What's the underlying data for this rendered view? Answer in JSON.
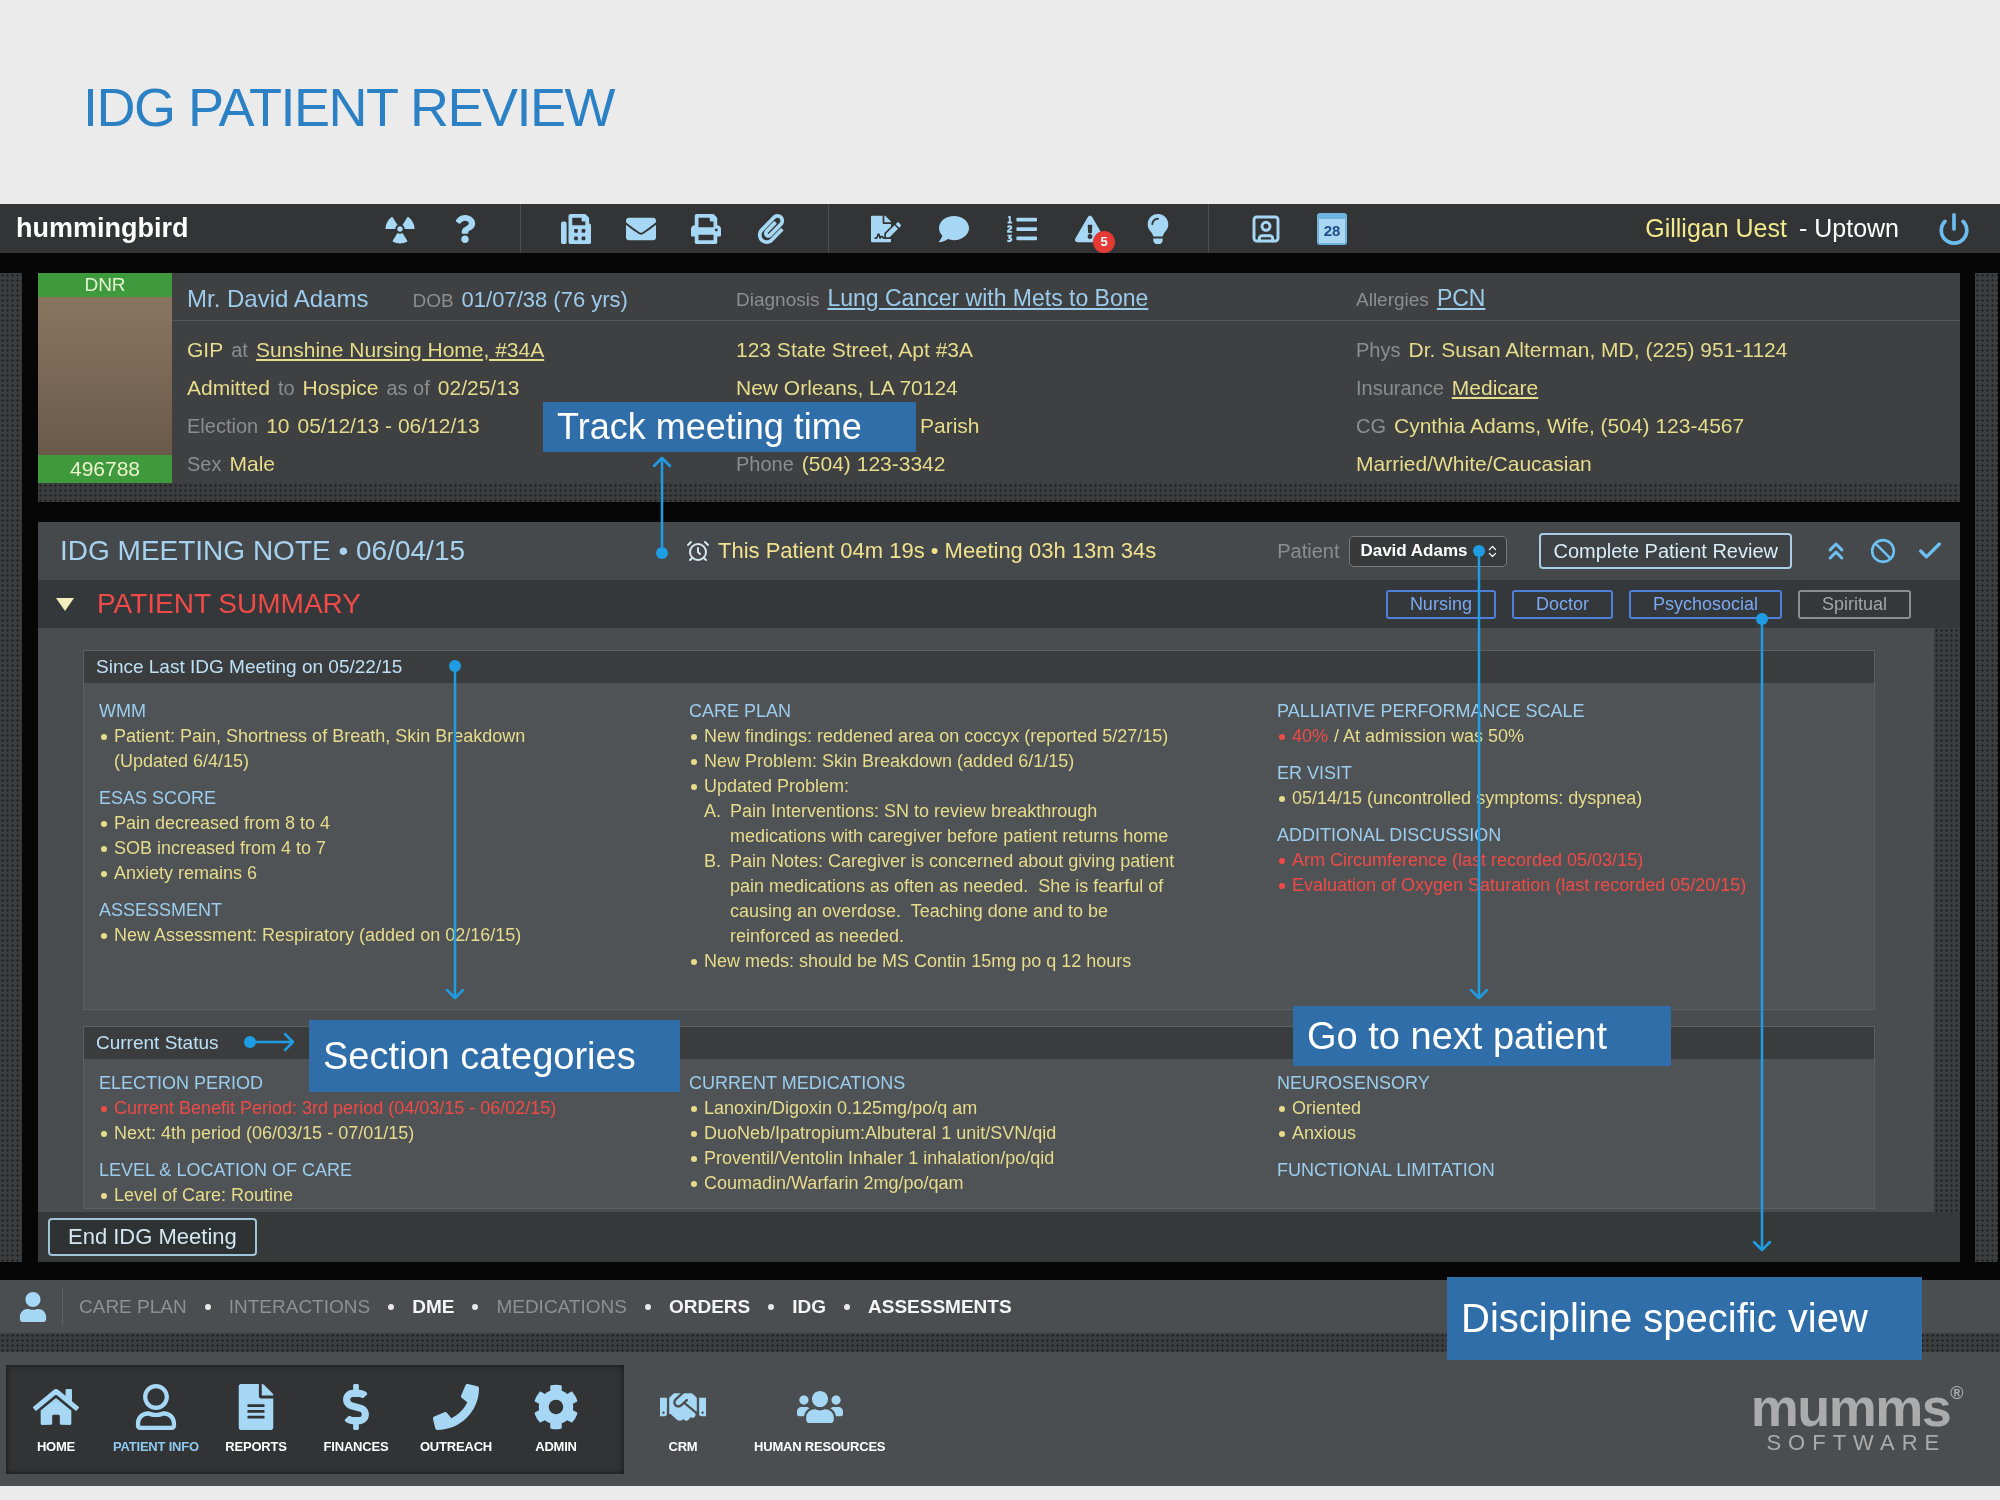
{
  "page_title": "IDG PATIENT REVIEW",
  "top_bar": {
    "app_name": "hummingbird",
    "alert_count": "5",
    "calendar_day": "28",
    "user_name": "Gilligan Uest",
    "location": "- Uptown"
  },
  "patient": {
    "status_tag": "DNR",
    "record_number": "496788",
    "headline": [
      [
        {
          "kind": "name",
          "text": "Mr. David Adams"
        },
        {
          "kind": "label",
          "text": "DOB"
        },
        {
          "kind": "value",
          "text": "01/07/38 (76 yrs)"
        }
      ],
      [
        {
          "kind": "label",
          "text": "Diagnosis"
        },
        {
          "kind": "link",
          "text": "Lung Cancer with Mets to Bone"
        }
      ],
      [
        {
          "kind": "label",
          "text": "Allergies"
        },
        {
          "kind": "link",
          "text": "PCN"
        }
      ]
    ],
    "details": [
      [
        [
          {
            "kind": "value",
            "text": "GIP"
          },
          {
            "kind": "label",
            "text": "at"
          },
          {
            "kind": "link",
            "text": "Sunshine Nursing Home, #34A"
          }
        ],
        [
          {
            "kind": "value",
            "text": "Admitted"
          },
          {
            "kind": "label",
            "text": "to"
          },
          {
            "kind": "value",
            "text": "Hospice"
          },
          {
            "kind": "label",
            "text": "as of"
          },
          {
            "kind": "value",
            "text": "02/25/13"
          }
        ],
        [
          {
            "kind": "label",
            "text": "Election"
          },
          {
            "kind": "value",
            "text": "10"
          },
          {
            "kind": "value",
            "text": "05/12/13 - 06/12/13"
          }
        ],
        [
          {
            "kind": "label",
            "text": "Sex"
          },
          {
            "kind": "value",
            "text": "Male"
          }
        ]
      ],
      [
        [
          {
            "kind": "value",
            "text": "123 State Street, Apt #3A"
          }
        ],
        [
          {
            "kind": "value",
            "text": "New Orleans, LA 70124"
          }
        ],
        [
          {
            "kind": "value",
            "text": "Parish"
          }
        ],
        [
          {
            "kind": "label",
            "text": "Phone"
          },
          {
            "kind": "value",
            "text": "(504) 123-3342"
          }
        ]
      ],
      [
        [
          {
            "kind": "label",
            "text": "Phys"
          },
          {
            "kind": "value",
            "text": "Dr. Susan Alterman, MD, (225) 951-1124"
          }
        ],
        [
          {
            "kind": "label",
            "text": "Insurance"
          },
          {
            "kind": "link",
            "text": "Medicare"
          }
        ],
        [
          {
            "kind": "label",
            "text": "CG"
          },
          {
            "kind": "value",
            "text": "Cynthia Adams, Wife, (504) 123-4567"
          }
        ],
        [
          {
            "kind": "value",
            "text": "Married/White/Caucasian"
          }
        ]
      ]
    ]
  },
  "meeting_note": {
    "title": "IDG MEETING NOTE • 06/04/15",
    "timer": "This Patient 04m 19s • Meeting 03h 13m 34s",
    "patient_picker": {
      "label": "Patient",
      "value": "David Adams"
    },
    "complete_button": "Complete Patient Review",
    "section": {
      "title": "PATIENT SUMMARY",
      "expanded": true
    },
    "discipline_filters": [
      {
        "label": "Nursing",
        "selected": true
      },
      {
        "label": "Doctor",
        "selected": true
      },
      {
        "label": "Psychosocial",
        "selected": true
      },
      {
        "label": "Spiritual",
        "selected": false
      }
    ],
    "cards": [
      {
        "title": "Since Last IDG Meeting on 05/22/15",
        "columns": [
          [
            {
              "heading": "WMM",
              "items": [
                {
                  "text": "Patient: Pain, Shortness of Breath, Skin Breakdown (Updated 6/4/15)",
                  "alert": false
                }
              ]
            },
            {
              "heading": "ESAS SCORE",
              "items": [
                {
                  "text": "Pain decreased from 8 to 4",
                  "alert": false
                },
                {
                  "text": "SOB increased from 4 to 7",
                  "alert": false
                },
                {
                  "text": "Anxiety remains 6",
                  "alert": false
                }
              ]
            },
            {
              "heading": "ASSESSMENT",
              "items": [
                {
                  "text": "New Assessment: Respiratory (added on 02/16/15)",
                  "alert": false
                }
              ]
            }
          ],
          [
            {
              "heading": "CARE PLAN",
              "items": [
                {
                  "text": "New findings: reddened area on coccyx (reported 5/27/15)",
                  "alert": false
                },
                {
                  "text": "New Problem: Skin Breakdown (added 6/1/15)",
                  "alert": false
                },
                {
                  "text": "Updated Problem:",
                  "alert": false,
                  "children": [
                    {
                      "marker": "A.",
                      "text": "Pain Interventions: SN to review breakthrough medications with caregiver before patient returns home"
                    },
                    {
                      "marker": "B.",
                      "text": "Pain Notes: Caregiver is concerned about giving patient pain medications as often as needed.  She is fearful of causing an overdose.  Teaching done and to be reinforced as needed."
                    }
                  ]
                },
                {
                  "text": "New meds: should be MS Contin 15mg po q 12 hours",
                  "alert": false
                }
              ]
            }
          ],
          [
            {
              "heading": "PALLIATIVE PERFORMANCE SCALE",
              "items": [
                {
                  "alert_lead": "40%",
                  "text": "/ At admission was 50%",
                  "alert": false
                }
              ]
            },
            {
              "heading": "ER VISIT",
              "items": [
                {
                  "text": "05/14/15 (uncontrolled symptoms: dyspnea)",
                  "alert": false
                }
              ]
            },
            {
              "heading": "ADDITIONAL DISCUSSION",
              "items": [
                {
                  "text": "Arm Circumference (last recorded 05/03/15)",
                  "alert": true
                },
                {
                  "text": "Evaluation of Oxygen Saturation (last recorded 05/20/15)",
                  "alert": true
                }
              ]
            }
          ]
        ]
      },
      {
        "title": "Current Status",
        "columns": [
          [
            {
              "heading": "ELECTION PERIOD",
              "items": [
                {
                  "text": "Current Benefit Period: 3rd period (04/03/15 - 06/02/15)",
                  "alert": true
                },
                {
                  "text": "Next: 4th period (06/03/15 - 07/01/15)",
                  "alert": false
                }
              ]
            },
            {
              "heading": "LEVEL & LOCATION OF CARE",
              "items": [
                {
                  "text": "Level of Care: Routine",
                  "alert": false
                }
              ]
            }
          ],
          [
            {
              "heading": "CURRENT MEDICATIONS",
              "items": [
                {
                  "text": "Lanoxin/Digoxin 0.125mg/po/q am",
                  "alert": false
                },
                {
                  "text": "DuoNeb/Ipatropium:Albuteral 1 unit/SVN/qid",
                  "alert": false
                },
                {
                  "text": "Proventil/Ventolin Inhaler 1 inhalation/po/qid",
                  "alert": false
                },
                {
                  "text": "Coumadin/Warfarin 2mg/po/qam",
                  "alert": false
                }
              ]
            }
          ],
          [
            {
              "heading": "NEUROSENSORY",
              "items": [
                {
                  "text": "Oriented",
                  "alert": false
                },
                {
                  "text": "Anxious",
                  "alert": false
                }
              ]
            },
            {
              "heading": "FUNCTIONAL LIMITATION"
            }
          ]
        ]
      }
    ],
    "end_button": "End IDG Meeting"
  },
  "record_tabs": [
    {
      "label": "CARE PLAN",
      "disabled": true
    },
    {
      "label": "INTERACTIONS",
      "disabled": true
    },
    {
      "label": "DME",
      "disabled": false
    },
    {
      "label": "MEDICATIONS",
      "disabled": true
    },
    {
      "label": "ORDERS",
      "disabled": false
    },
    {
      "label": "IDG",
      "disabled": false
    },
    {
      "label": "ASSESSMENTS",
      "disabled": false
    }
  ],
  "app_launcher": {
    "main": [
      {
        "kind": "home",
        "label": "HOME",
        "selected": false
      },
      {
        "kind": "patient",
        "label": "PATIENT INFO",
        "selected": true
      },
      {
        "kind": "reports",
        "label": "REPORTS",
        "selected": false
      },
      {
        "kind": "finances",
        "label": "FINANCES",
        "selected": false
      },
      {
        "kind": "outreach",
        "label": "OUTREACH",
        "selected": false
      },
      {
        "kind": "admin",
        "label": "ADMIN",
        "selected": false
      }
    ],
    "more": [
      {
        "kind": "crm",
        "label": "CRM",
        "selected": false
      },
      {
        "kind": "staff",
        "label": "HUMAN RESOURCES",
        "selected": false
      }
    ]
  },
  "brand": {
    "name": "mumms$^{®}$",
    "tagline": "SOFTWARE"
  },
  "annotations": [
    "Track meeting time",
    "Section categories",
    "Go to next patient",
    "Discipline specific view"
  ]
}
